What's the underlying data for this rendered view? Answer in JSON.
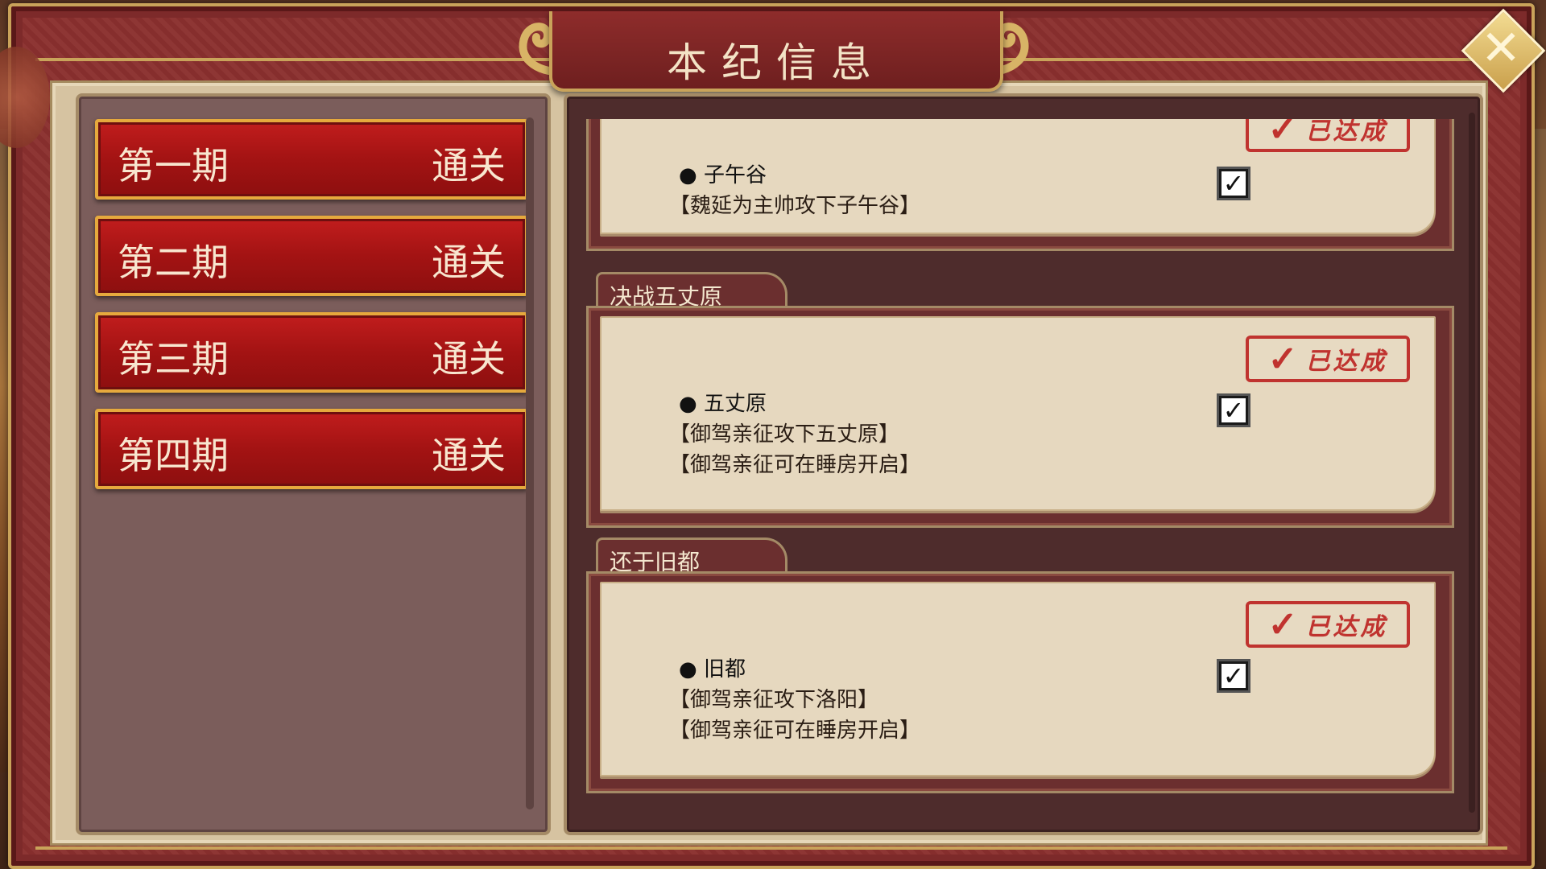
{
  "title": "本纪信息",
  "icons": {
    "close": "close-x-icon",
    "check": "check-icon",
    "bullet": "bullet-icon",
    "stamp": "achieved-stamp"
  },
  "colors": {
    "frame": "#7d2a2a",
    "gold": "#c9a35a",
    "button_red": "#a31313",
    "paper": "#e6d8bf",
    "stamp_red": "#c0332f"
  },
  "periods": [
    {
      "name": "第一期",
      "status": "通关"
    },
    {
      "name": "第二期",
      "status": "通关"
    },
    {
      "name": "第三期",
      "status": "通关"
    },
    {
      "name": "第四期",
      "status": "通关"
    }
  ],
  "sections": [
    {
      "tab": "",
      "stamp": "已达成",
      "objective": "子午谷",
      "conditions": [
        "【魏延为主帅攻下子午谷】"
      ],
      "checked": true
    },
    {
      "tab": "决战五丈原",
      "stamp": "已达成",
      "objective": "五丈原",
      "conditions": [
        "【御驾亲征攻下五丈原】",
        "【御驾亲征可在睡房开启】"
      ],
      "checked": true
    },
    {
      "tab": "还于旧都",
      "stamp": "已达成",
      "objective": "旧都",
      "conditions": [
        "【御驾亲征攻下洛阳】",
        "【御驾亲征可在睡房开启】"
      ],
      "checked": true
    }
  ]
}
